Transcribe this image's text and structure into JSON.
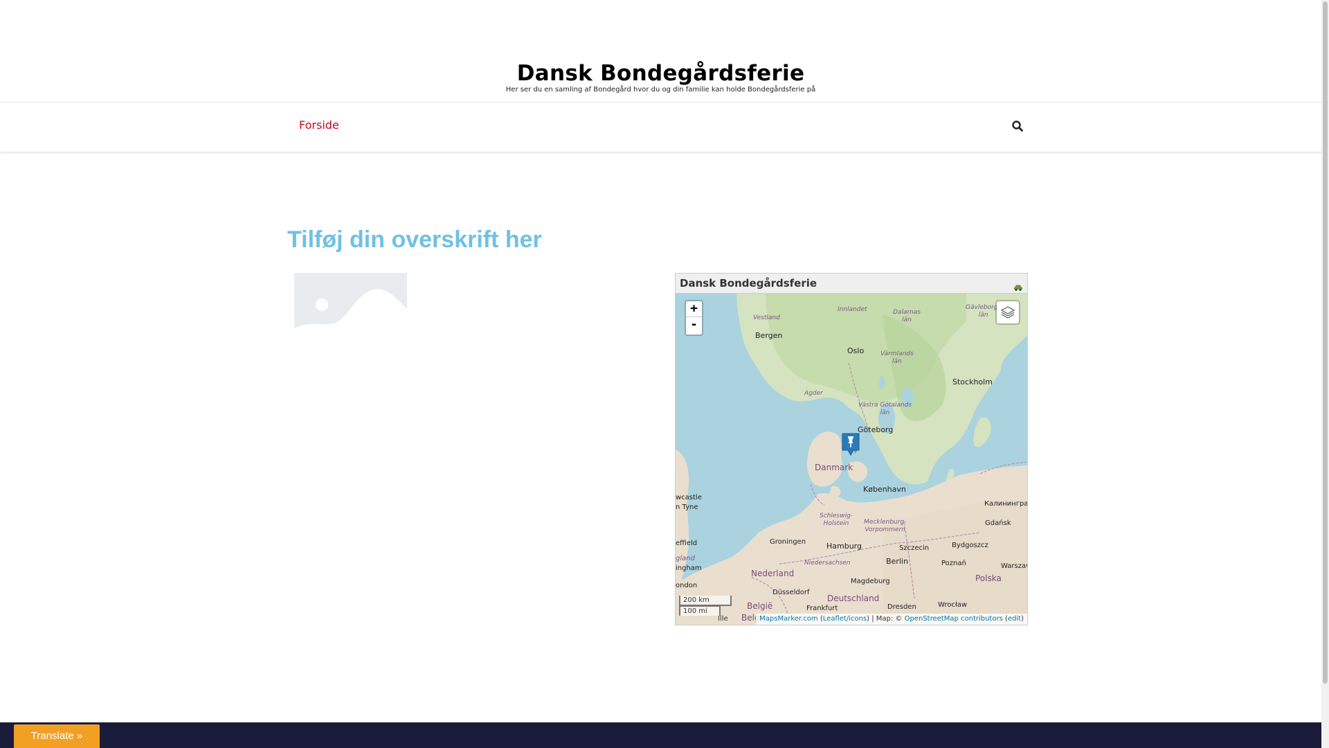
{
  "site": {
    "title": "Dansk Bondegårdsferie",
    "tagline": "Her ser du en samling af Bondegård hvor du og din familie kan holde Bondegårdsferie på"
  },
  "nav": {
    "home_label": "Forside",
    "search_icon": "search-icon"
  },
  "main": {
    "heading": "Tilføj din overskrift her",
    "image_icon": "image-placeholder-icon"
  },
  "map": {
    "title": "Dansk Bondegårdsferie",
    "header_icon": "car-icon",
    "zoom_in": "+",
    "zoom_out": "-",
    "layers_icon": "layers-icon",
    "marker_icon": "pin-marker-icon",
    "scale_km": "200 km",
    "scale_mi": "100 mi",
    "attribution": {
      "prefix": "Ille",
      "mapsmarker": "MapsMarker.com",
      "leaflet": "Leaflet/icons",
      "map_text": "| Map: ©",
      "osm": "OpenStreetMap contributors",
      "edit": "edit"
    },
    "labels": {
      "vestland": "Vestland",
      "innlandet": "Innlandet",
      "dalarnas": "Dalarnas\nlän",
      "gavleborgs": "Gävleborgs\nlän",
      "bergen": "Bergen",
      "oslo": "Oslo",
      "varmlands": "Värmlands\nlän",
      "stockholm": "Stockholm",
      "agder": "Agder",
      "vastra": "Västra Götalands\nlän",
      "goteborg": "Göteborg",
      "danmark": "Danmark",
      "kobenhavn": "København",
      "newcastle": "wcastle\nn Tyne",
      "kaliningrad": "Калининград",
      "schleswig": "Schleswig-\nHolstein",
      "mecklenburg": "Mecklenburg-\nVorpommern",
      "gdansk": "Gdańsk",
      "sheffield": "effield",
      "groningen": "Groningen",
      "hamburg": "Hamburg",
      "szczecin": "Szczecin",
      "bydgoszcz": "Bydgoszcz",
      "ngland": "gland",
      "niedersachsen": "Niedersachsen",
      "berlin": "Berlin",
      "poznan": "Poznań",
      "warszawa": "Warszaw",
      "ingham": "ingham",
      "nederland": "Nederland",
      "polska": "Polska",
      "magdeburg": "Magdeburg",
      "london": "ondon",
      "dusseldorf": "Düsseldorf",
      "deutschland": "Deutschland",
      "belgie": "België",
      "frankfurt": "Frankfurt",
      "dresden": "Dresden",
      "wroclaw": "Wrocław",
      "belgi2": "Belgi"
    }
  },
  "footer": {
    "translate_label": "Translate »"
  },
  "colors": {
    "nav_link": "#d0021b",
    "heading": "#6ec1e4",
    "water": "#aad3df",
    "footer": "#1a1b3a",
    "translate": "#f2a024",
    "marker": "#2a7ab8"
  }
}
